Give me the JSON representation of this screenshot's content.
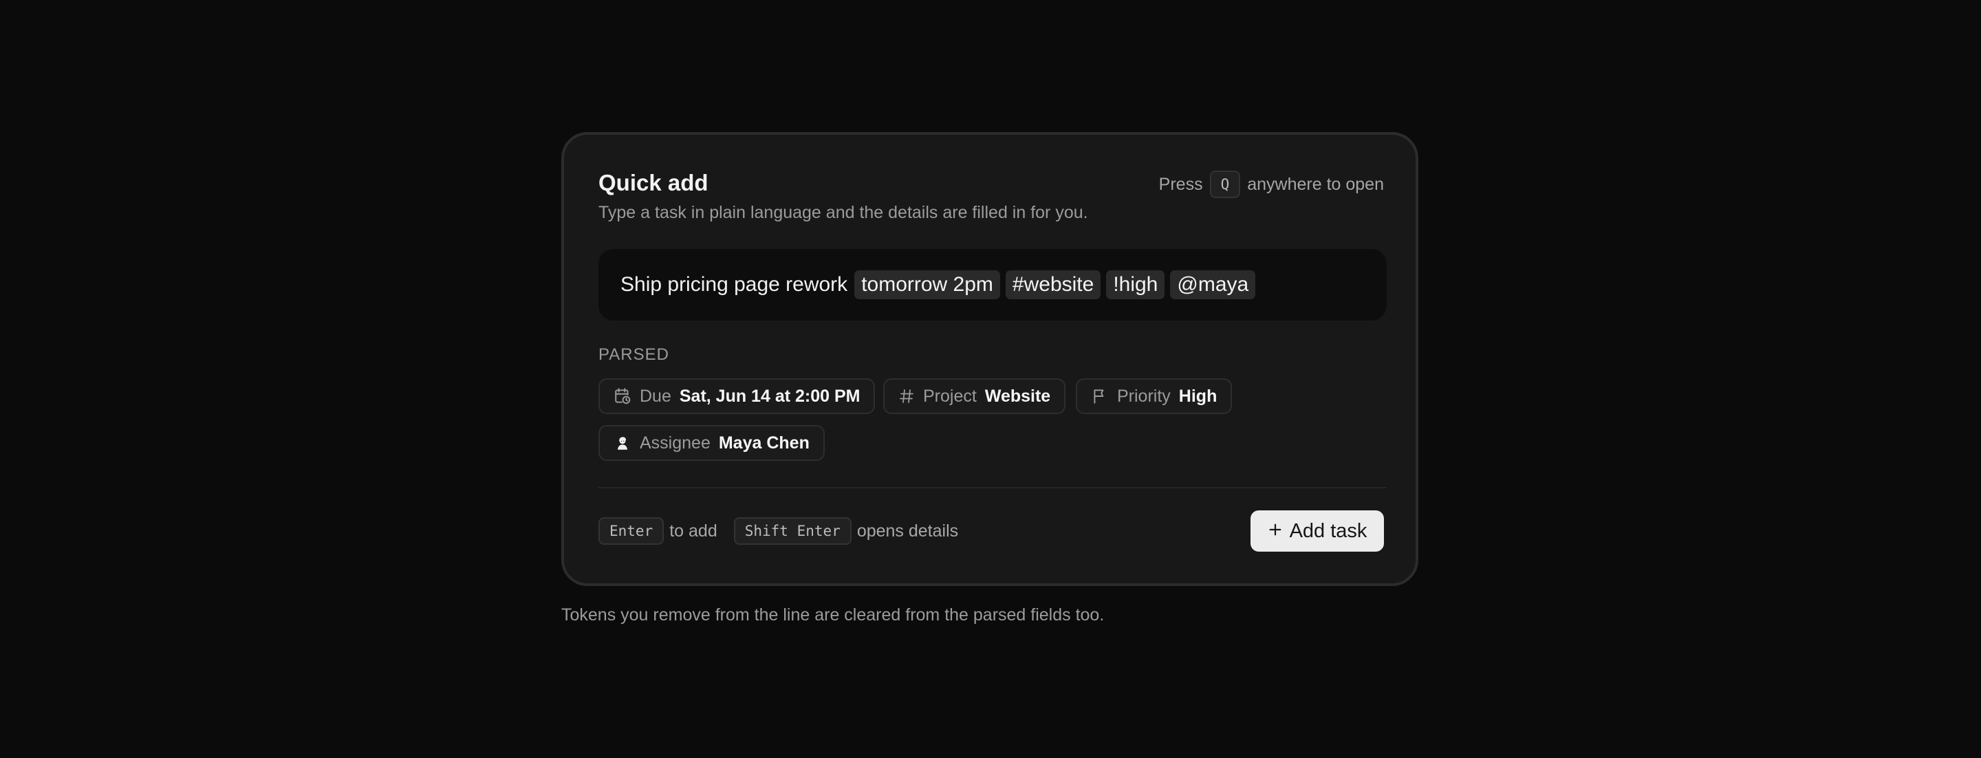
{
  "header": {
    "title": "Quick add",
    "subtitle": "Type a task in plain language and the details are filled in for you.",
    "hint_prefix": "Press",
    "hint_key": "Q",
    "hint_suffix": "anywhere to open"
  },
  "input": {
    "text": "Ship pricing page rework",
    "tokens": [
      "tomorrow 2pm",
      "#website",
      "!high",
      "@maya"
    ]
  },
  "parsed": {
    "label": "PARSED",
    "fields": [
      {
        "icon": "calendar-clock-icon",
        "label": "Due",
        "value": "Sat, Jun 14 at 2:00 PM"
      },
      {
        "icon": "hash-icon",
        "label": "Project",
        "value": "Website"
      },
      {
        "icon": "flag-icon",
        "label": "Priority",
        "value": "High"
      },
      {
        "icon": "avatar-icon",
        "label": "Assignee",
        "value": "Maya Chen"
      }
    ]
  },
  "footer": {
    "enter_key": "Enter",
    "enter_text": "to add",
    "shift_enter_key": "Shift Enter",
    "shift_enter_text": "opens details",
    "add_button_label": "Add task"
  },
  "footnote": "Tokens you remove from the line are cleared from the parsed fields too."
}
